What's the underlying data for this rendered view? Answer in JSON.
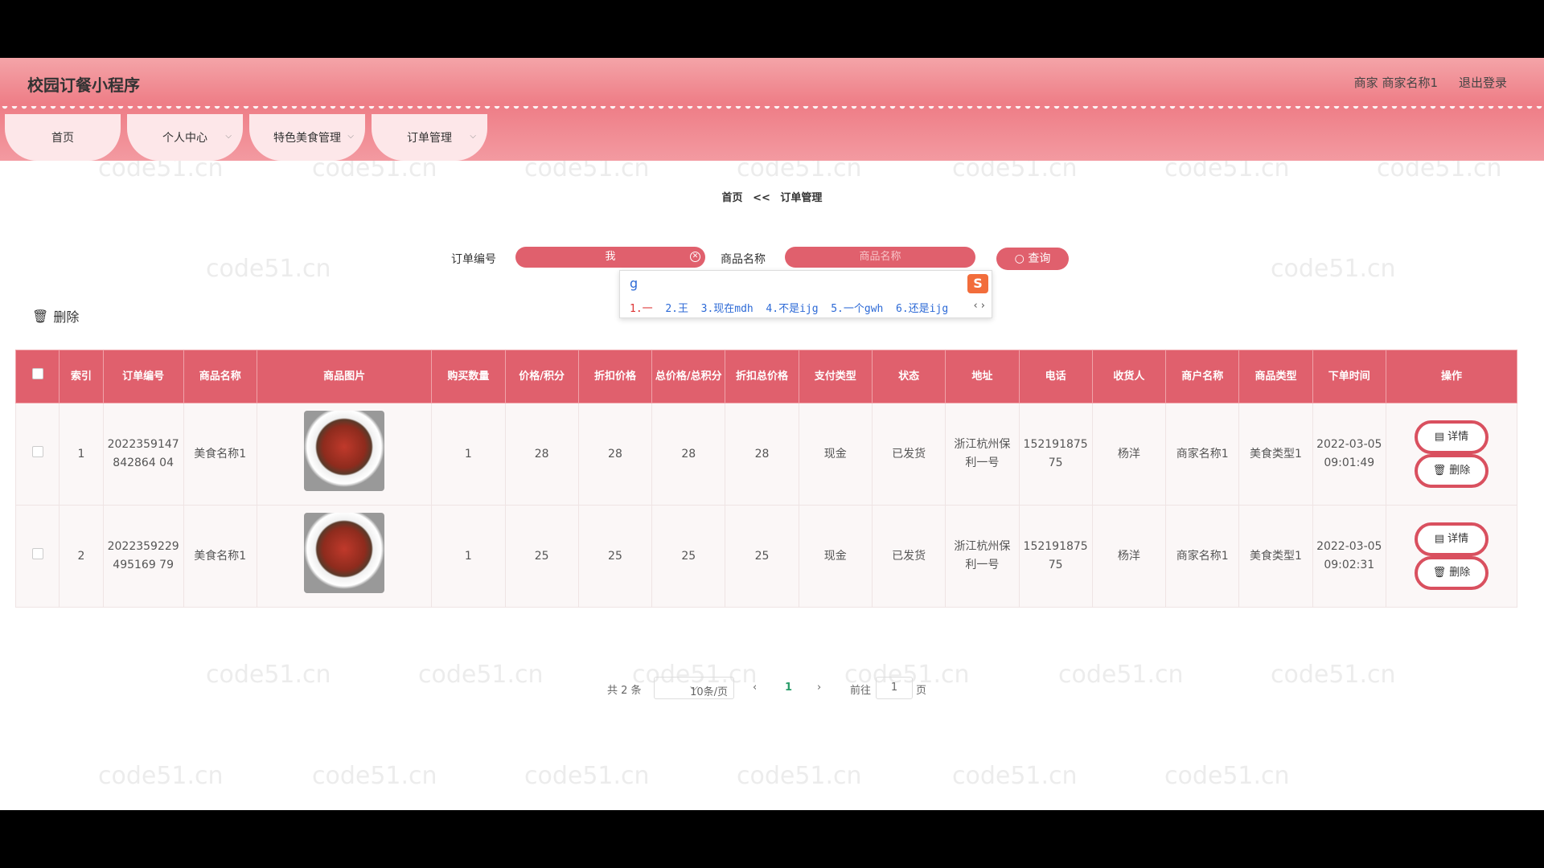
{
  "app": {
    "title": "校园订餐小程序"
  },
  "user": {
    "role_name": "商家 商家名称1",
    "logout": "退出登录"
  },
  "nav": [
    {
      "label": "首页"
    },
    {
      "label": "个人中心"
    },
    {
      "label": "特色美食管理"
    },
    {
      "label": "订单管理"
    }
  ],
  "breadcrumb": {
    "home": "首页",
    "sep": "<<",
    "current": "订单管理"
  },
  "search": {
    "order_label": "订单编号",
    "order_value": "我",
    "product_label": "商品名称",
    "product_placeholder": "商品名称",
    "query_label": "查询"
  },
  "ime": {
    "typed": "g",
    "candidates": [
      "1.一",
      "2.王",
      "3.现在mdh",
      "4.不是ijg",
      "5.一个gwh",
      "6.还是ijg"
    ]
  },
  "toolbar": {
    "delete_label": "删除"
  },
  "table": {
    "headers": [
      "索引",
      "订单编号",
      "商品名称",
      "商品图片",
      "购买数量",
      "价格/积分",
      "折扣价格",
      "总价格/总积分",
      "折扣总价格",
      "支付类型",
      "状态",
      "地址",
      "电话",
      "收货人",
      "商户名称",
      "商品类型",
      "下单时间",
      "操作"
    ],
    "rows": [
      {
        "index": "1",
        "order_no": "2022359147842864 04",
        "product": "美食名称1",
        "qty": "1",
        "price": "28",
        "discount": "28",
        "total": "28",
        "discount_total": "28",
        "pay": "现金",
        "status": "已发货",
        "address": "浙江杭州保利一号",
        "phone": "15219187575",
        "receiver": "杨洋",
        "merchant": "商家名称1",
        "type": "美食类型1",
        "time": "2022-03-05 09:01:49",
        "detail": "详情",
        "delete": "删除"
      },
      {
        "index": "2",
        "order_no": "2022359229495169 79",
        "product": "美食名称1",
        "qty": "1",
        "price": "25",
        "discount": "25",
        "total": "25",
        "discount_total": "25",
        "pay": "现金",
        "status": "已发货",
        "address": "浙江杭州保利一号",
        "phone": "15219187575",
        "receiver": "杨洋",
        "merchant": "商家名称1",
        "type": "美食类型1",
        "time": "2022-03-05 09:02:31",
        "detail": "详情",
        "delete": "删除"
      }
    ]
  },
  "pager": {
    "total": "共 2 条",
    "page_size": "10条/页",
    "current": "1",
    "goto_label": "前往",
    "goto_value": "1",
    "page_unit": "页"
  },
  "watermark": "code51.cn",
  "colors": {
    "accent": "#e0606d",
    "header_light": "#f4a4a8"
  }
}
